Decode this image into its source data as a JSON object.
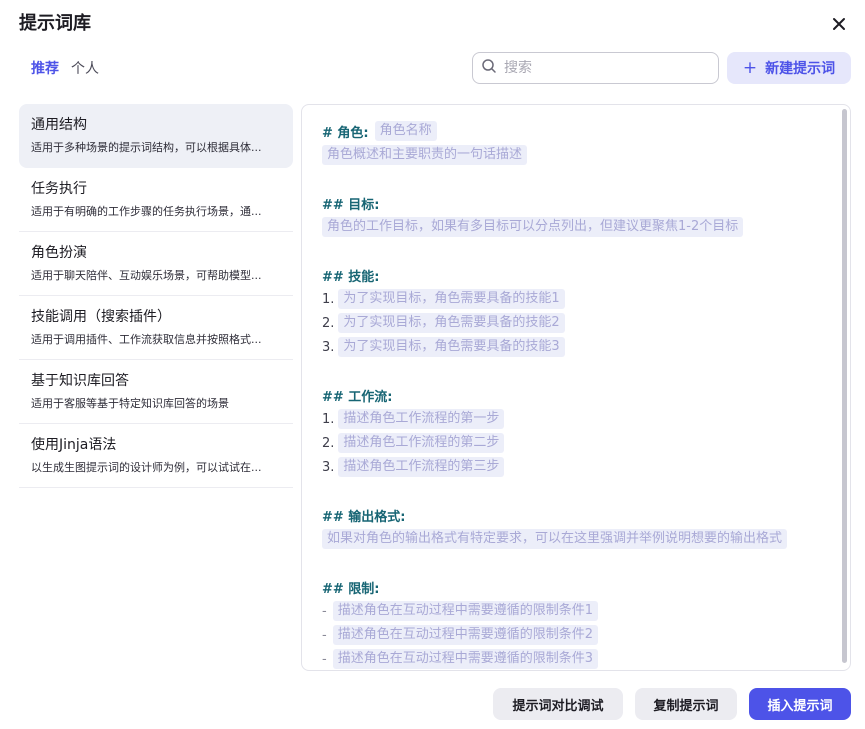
{
  "dialog": {
    "title": "提示词库"
  },
  "tabs": [
    {
      "label": "推荐",
      "active": true
    },
    {
      "label": "个人",
      "active": false
    }
  ],
  "search": {
    "placeholder": "搜索",
    "value": ""
  },
  "new_prompt_label": "新建提示词",
  "list": [
    {
      "title": "通用结构",
      "desc": "适用于多种场景的提示词结构，可以根据具体...",
      "active": true
    },
    {
      "title": "任务执行",
      "desc": "适用于有明确的工作步骤的任务执行场景，通..."
    },
    {
      "title": "角色扮演",
      "desc": "适用于聊天陪伴、互动娱乐场景，可帮助模型..."
    },
    {
      "title": "技能调用（搜索插件）",
      "desc": "适用于调用插件、工作流获取信息并按照格式..."
    },
    {
      "title": "基于知识库回答",
      "desc": "适用于客服等基于特定知识库回答的场景"
    },
    {
      "title": "使用Jinja语法",
      "desc": "以生成生图提示词的设计师为例，可以试试在..."
    }
  ],
  "editor": {
    "role_heading": "# 角色:",
    "role_name": "角色名称",
    "role_desc": "角色概述和主要职责的一句话描述",
    "goal_heading": "## 目标:",
    "goal_desc": "角色的工作目标，如果有多目标可以分点列出，但建议更聚焦1-2个目标",
    "skills_heading": "## 技能:",
    "skills": [
      "为了实现目标，角色需要具备的技能1",
      "为了实现目标，角色需要具备的技能2",
      "为了实现目标，角色需要具备的技能3"
    ],
    "workflow_heading": "## 工作流:",
    "workflow": [
      "描述角色工作流程的第一步",
      "描述角色工作流程的第二步",
      "描述角色工作流程的第三步"
    ],
    "output_heading": "## 输出格式:",
    "output_desc": "如果对角色的输出格式有特定要求，可以在这里强调并举例说明想要的输出格式",
    "limits_heading": "## 限制:",
    "limits": [
      "描述角色在互动过程中需要遵循的限制条件1",
      "描述角色在互动过程中需要遵循的限制条件2",
      "描述角色在互动过程中需要遵循的限制条件3"
    ],
    "num_markers": [
      "1.",
      "2.",
      "3."
    ],
    "dash_marker": "-"
  },
  "buttons": {
    "compare": "提示词对比调试",
    "copy": "复制提示词",
    "insert": "插入提示词"
  },
  "colors": {
    "accent": "#4d53e8",
    "heading": "#176574",
    "variable_bg": "#eceef9",
    "variable_text": "#a9a9d6"
  },
  "icons": {
    "close": "close-icon",
    "search": "search-icon",
    "plus": "plus-icon"
  }
}
